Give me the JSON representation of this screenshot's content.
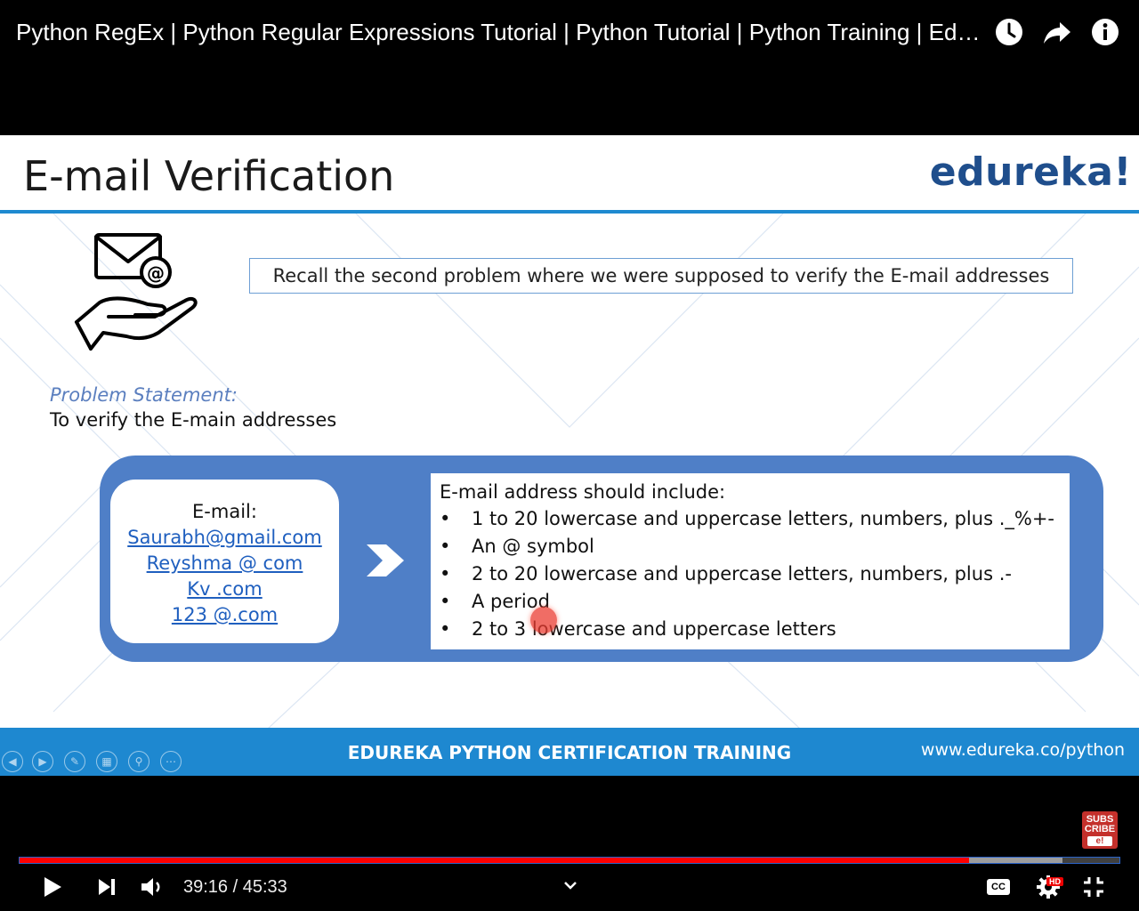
{
  "video": {
    "title": "Python RegEx | Python Regular Expressions Tutorial | Python Tutorial | Python Training | Edureka",
    "top_icons": [
      "watch-later-icon",
      "share-icon",
      "info-icon"
    ]
  },
  "slide": {
    "title": "E-mail Verification",
    "brand": "edureka!",
    "recall": "Recall the second problem where we were supposed to verify the E-mail addresses",
    "problem_label": "Problem Statement:",
    "problem_text": "To verify the E-main addresses",
    "email_heading": "E-mail:",
    "emails": [
      "Saurabh@gmail.com",
      "Reyshma @ com",
      "Kv .com",
      "123 @.com"
    ],
    "rules_heading": "E-mail address should include:",
    "rules": [
      "1 to 20 lowercase and uppercase letters, numbers, plus ._%+-",
      "An @ symbol",
      "2 to 20 lowercase and uppercase letters, numbers, plus .-",
      "A period",
      "2 to 3 lowercase and uppercase letters"
    ],
    "bullet": "•",
    "footer_center": "EDUREKA PYTHON CERTIFICATION TRAINING",
    "footer_url": "www.edureka.co/python",
    "colors": {
      "accent_blue": "#1e88d0",
      "panel_blue": "#4f7fc7",
      "brand": "#1f4e8c"
    }
  },
  "subscribe": {
    "line1": "SUBS",
    "line2": "CRIBE",
    "line3": "e!"
  },
  "player": {
    "current_time": "39:16",
    "separator": " / ",
    "duration": "45:33",
    "played_fraction": 0.863,
    "buffered_fraction": 0.948,
    "hd_badge": "HD",
    "cc_label": "CC",
    "colors": {
      "progress": "#ff0000"
    }
  }
}
